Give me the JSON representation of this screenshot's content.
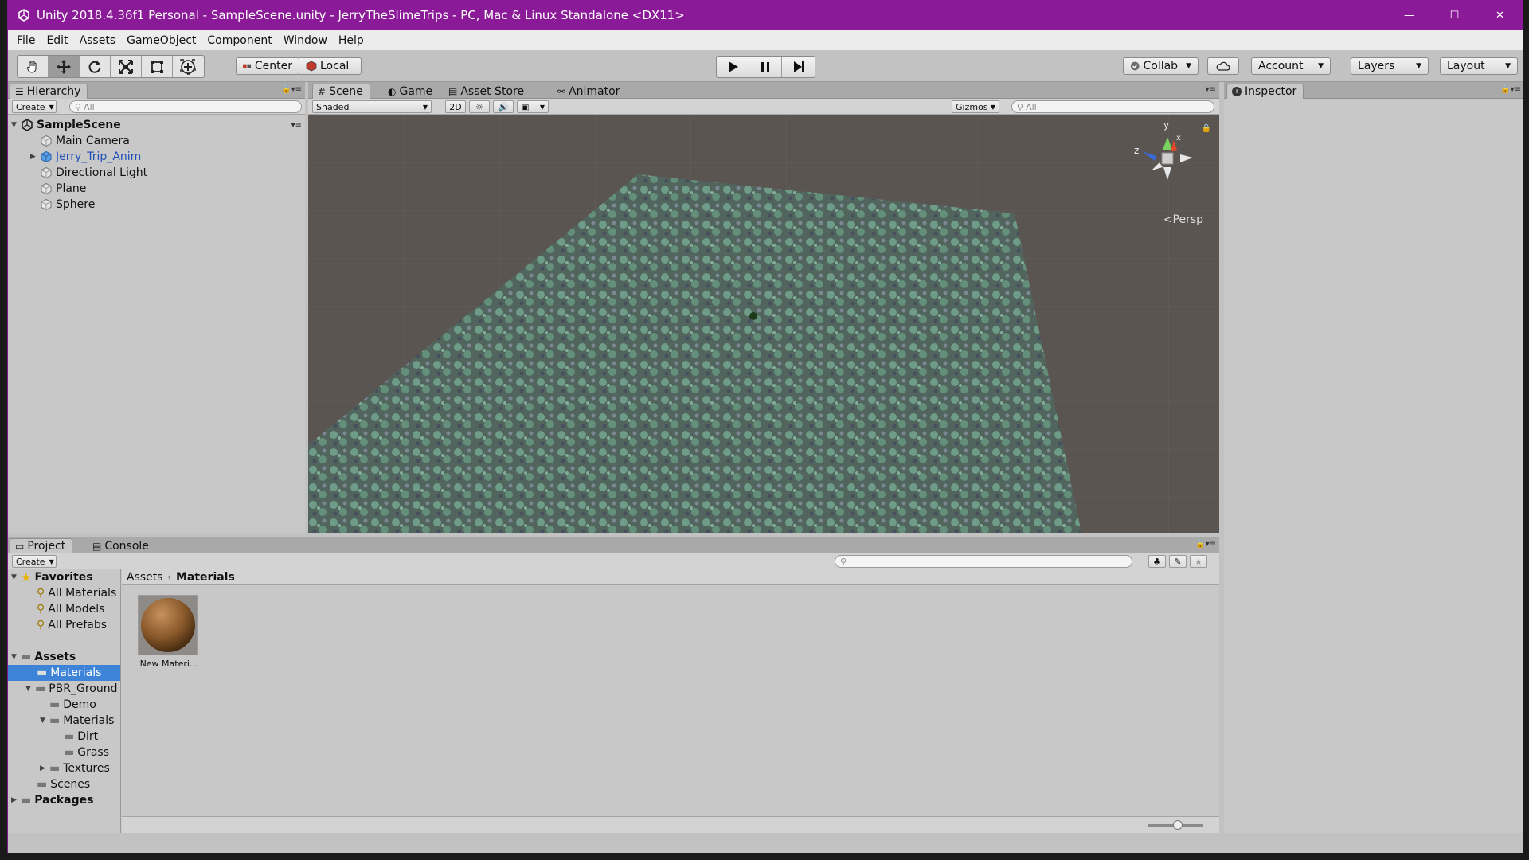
{
  "window": {
    "title": "Unity 2018.4.36f1 Personal - SampleScene.unity - JerryTheSlimeTrips - PC, Mac & Linux Standalone <DX11>",
    "minimize_glyph": "—",
    "maximize_glyph": "☐",
    "close_glyph": "✕"
  },
  "menu": [
    "File",
    "Edit",
    "Assets",
    "GameObject",
    "Component",
    "Window",
    "Help"
  ],
  "toolbar": {
    "pivot_label": "Center",
    "space_label": "Local",
    "collab_label": "Collab",
    "account_label": "Account",
    "layers_label": "Layers",
    "layout_label": "Layout"
  },
  "hierarchy": {
    "tab_label": "Hierarchy",
    "create_label": "Create",
    "search_placeholder": "All",
    "scene_name": "SampleScene",
    "items": [
      {
        "label": "Main Camera",
        "icon": "gameobject-icon"
      },
      {
        "label": "Jerry_Trip_Anim",
        "icon": "prefab-icon",
        "color": "#1f4fb8"
      },
      {
        "label": "Directional Light",
        "icon": "gameobject-icon"
      },
      {
        "label": "Plane",
        "icon": "gameobject-icon"
      },
      {
        "label": "Sphere",
        "icon": "gameobject-icon"
      }
    ]
  },
  "scene_panel": {
    "tabs": [
      "Scene",
      "Game",
      "Asset Store",
      "Animator"
    ],
    "shading_label": "Shaded",
    "mode_2d_label": "2D",
    "gizmos_label": "Gizmos",
    "search_placeholder": "All",
    "persp_label": "Persp",
    "axis_labels": {
      "y": "y",
      "z": "z",
      "x": "x"
    },
    "ground_color": "#5c7c6c",
    "background_color": "#5b5552"
  },
  "inspector": {
    "tab_label": "Inspector"
  },
  "project": {
    "tabs": [
      "Project",
      "Console"
    ],
    "create_label": "Create",
    "favorites_label": "Favorites",
    "favorites": [
      "All Materials",
      "All Models",
      "All Prefabs"
    ],
    "assets_label": "Assets",
    "folders": [
      "Materials",
      "PBR_Ground",
      "Demo",
      "Materials",
      "Dirt",
      "Grass",
      "Textures",
      "Scenes"
    ],
    "packages_label": "Packages",
    "breadcrumb": [
      "Assets",
      "Materials"
    ],
    "assets_grid": [
      {
        "label": "New Materi...",
        "color": "#8b5a2b"
      }
    ]
  },
  "colors": {
    "title_bar": "#8b1a98",
    "selection": "#3d84d9",
    "editor_bg": "#c2c2c2"
  }
}
